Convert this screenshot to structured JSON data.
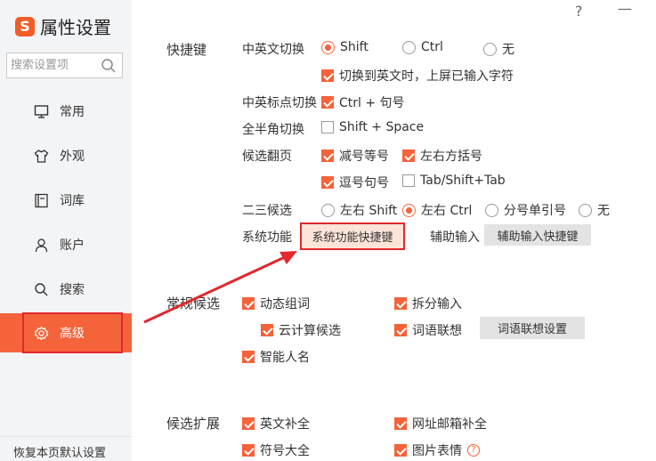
{
  "window": {
    "title": "属性设置",
    "logo_glyph": "S",
    "help_label": "?",
    "minimize_label": "—",
    "accent_color": "#f4633a",
    "highlight_color": "#e0282e"
  },
  "sidebar": {
    "search_placeholder": "搜索设置项",
    "items": [
      {
        "label": "常用",
        "icon": "monitor-icon"
      },
      {
        "label": "外观",
        "icon": "shirt-icon"
      },
      {
        "label": "词库",
        "icon": "book-icon"
      },
      {
        "label": "账户",
        "icon": "user-icon"
      },
      {
        "label": "搜索",
        "icon": "search-icon"
      },
      {
        "label": "高级",
        "icon": "gear-icon",
        "active": true
      }
    ],
    "restore_label": "恢复本页默认设置"
  },
  "shortcut": {
    "section_title": "快捷键",
    "cn_en_switch": {
      "label": "中英文切换",
      "options": [
        "Shift",
        "Ctrl",
        "无"
      ],
      "selected": "Shift",
      "commit_label": "切换到英文时，上屏已输入字符"
    },
    "punct_switch": {
      "label": "中英标点切换",
      "option": "Ctrl + 句号"
    },
    "width_switch": {
      "label": "全半角切换",
      "option": "Shift + Space"
    },
    "page_turn": {
      "label": "候选翻页",
      "options": [
        "减号等号",
        "左右方括号",
        "逗号句号",
        "Tab/Shift+Tab"
      ]
    },
    "second_third": {
      "label": "二三候选",
      "options": [
        "左右 Shift",
        "左右 Ctrl",
        "分号单引号",
        "无"
      ],
      "selected": "左右 Ctrl"
    },
    "system": {
      "label": "系统功能",
      "button": "系统功能快捷键"
    },
    "assist": {
      "label": "辅助输入",
      "button": "辅助输入快捷键"
    }
  },
  "candidate": {
    "section_title": "常规候选",
    "options": [
      "动态组词",
      "拆分输入",
      "云计算候选",
      "词语联想",
      "智能人名"
    ],
    "assoc_button": "词语联想设置"
  },
  "extension": {
    "section_title": "候选扩展",
    "options": [
      "英文补全",
      "网址邮箱补全",
      "符号大全",
      "图片表情"
    ]
  }
}
